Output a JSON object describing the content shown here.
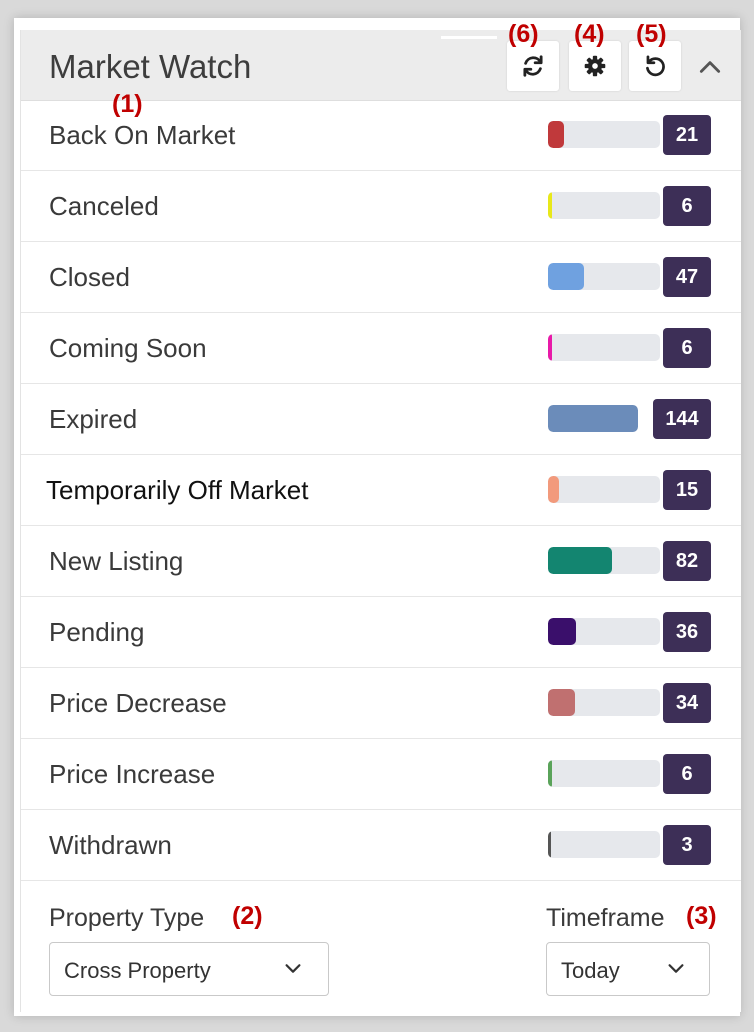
{
  "widget": {
    "title": "Market Watch",
    "toolbar": {
      "refresh_icon": "refresh-icon",
      "settings_icon": "gear-icon",
      "reset_icon": "undo-icon",
      "collapse_icon": "chevron-up-icon"
    }
  },
  "annotations": {
    "a1": "(1)",
    "a2": "(2)",
    "a3": "(3)",
    "a4": "(4)",
    "a5": "(5)",
    "a6": "(6)"
  },
  "rows": [
    {
      "label": "Back On Market",
      "count": "21",
      "color": "#c0393b",
      "fill": 0.14
    },
    {
      "label": "Canceled",
      "count": "6",
      "color": "#e8e81a",
      "fill": 0.04
    },
    {
      "label": "Closed",
      "count": "47",
      "color": "#6fa1e0",
      "fill": 0.32
    },
    {
      "label": "Coming Soon",
      "count": "6",
      "color": "#e81aa8",
      "fill": 0.04
    },
    {
      "label": "Expired",
      "count": "144",
      "color": "#6b8cba",
      "fill": 1.0
    },
    {
      "label": "Temporarily Off Market",
      "count": "15",
      "color": "#f29a7c",
      "fill": 0.1
    },
    {
      "label": "New Listing",
      "count": "82",
      "color": "#138570",
      "fill": 0.57
    },
    {
      "label": "Pending",
      "count": "36",
      "color": "#3a0f6b",
      "fill": 0.25
    },
    {
      "label": "Price Decrease",
      "count": "34",
      "color": "#c07070",
      "fill": 0.24
    },
    {
      "label": "Price Increase",
      "count": "6",
      "color": "#5aa35a",
      "fill": 0.04
    },
    {
      "label": "Withdrawn",
      "count": "3",
      "color": "#555555",
      "fill": 0.02
    }
  ],
  "filters": {
    "property_type_label": "Property Type",
    "property_type_value": "Cross Property",
    "timeframe_label": "Timeframe",
    "timeframe_value": "Today"
  }
}
